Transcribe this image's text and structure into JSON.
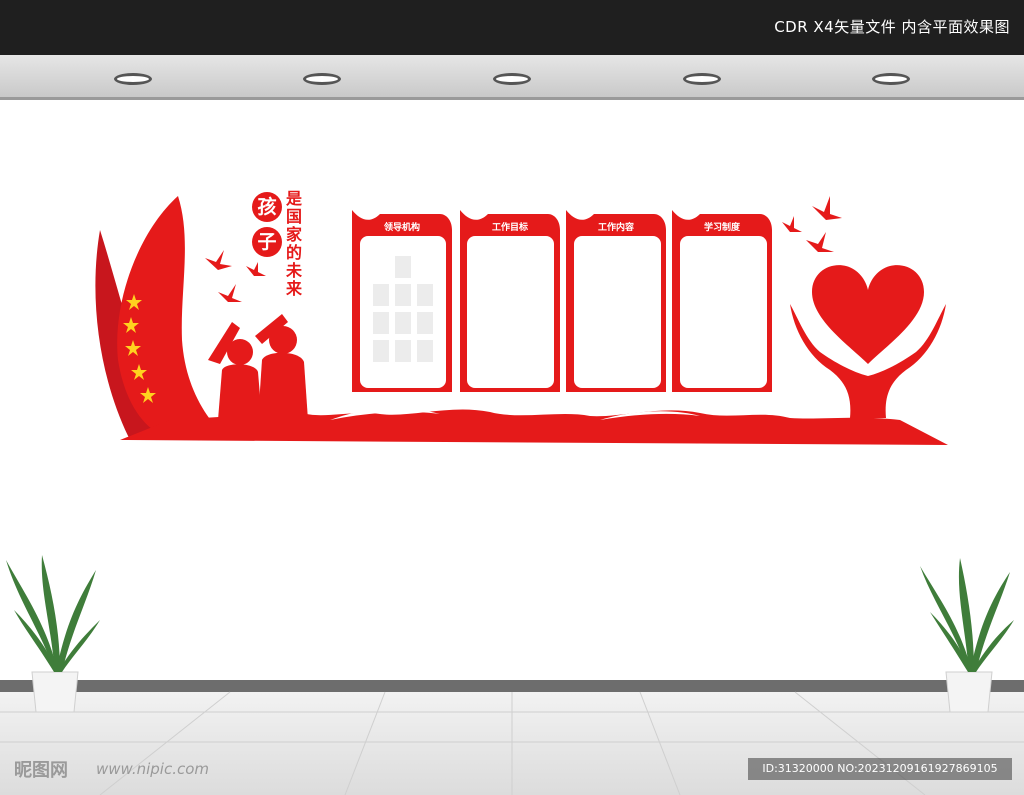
{
  "header": {
    "title": "CDR X4矢量文件  内含平面效果图"
  },
  "slogan": {
    "big_chars": [
      "孩",
      "子"
    ],
    "rest": "是国家的未来"
  },
  "panels": [
    {
      "title": "领导机构"
    },
    {
      "title": "工作目标"
    },
    {
      "title": "工作内容"
    },
    {
      "title": "学习制度"
    }
  ],
  "watermark": {
    "logo": "昵图网",
    "url": "www.nipic.com",
    "id": "ID:31320000 NO:20231209161927869105"
  },
  "colors": {
    "accent": "#e51a1a",
    "dark": "#1f1f1f",
    "star": "#ffd21f"
  },
  "icons": [
    "star-icon",
    "dove-icon",
    "heart-icon",
    "hands-icon",
    "children-silhouette-icon",
    "plant-icon",
    "ceiling-light-icon"
  ]
}
